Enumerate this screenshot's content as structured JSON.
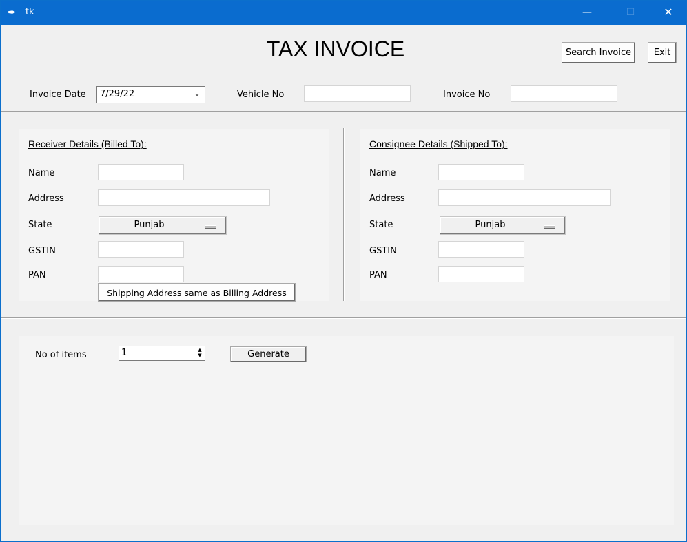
{
  "window": {
    "title": "tk",
    "minimize": "—",
    "maximize": "☐",
    "close": "✕"
  },
  "header": {
    "title": "TAX INVOICE",
    "search_button": "Search Invoice",
    "exit_button": "Exit"
  },
  "invoice": {
    "date_label": "Invoice Date",
    "date_value": "7/29/22",
    "vehicle_label": "Vehicle No",
    "vehicle_value": "",
    "invoice_no_label": "Invoice No",
    "invoice_no_value": ""
  },
  "receiver": {
    "heading": "Receiver Details (Billed To):",
    "name_label": "Name",
    "address_label": "Address",
    "state_label": "State",
    "state_value": "Punjab",
    "gstin_label": "GSTIN",
    "pan_label": "PAN",
    "same_button": "Shipping Address same as Billing Address"
  },
  "consignee": {
    "heading": "Consignee Details (Shipped To):",
    "name_label": "Name",
    "address_label": "Address",
    "state_label": "State",
    "state_value": "Punjab",
    "gstin_label": "GSTIN",
    "pan_label": "PAN"
  },
  "items": {
    "count_label": "No of items",
    "count_value": "1",
    "generate_button": "Generate"
  }
}
